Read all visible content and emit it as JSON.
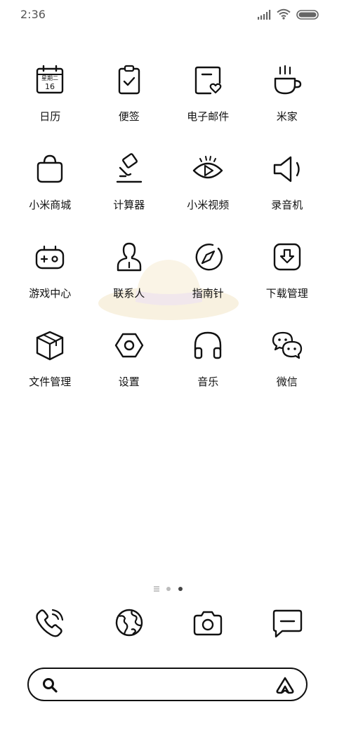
{
  "status_bar": {
    "time": "2:36",
    "icons": [
      "signal-icon",
      "wifi-icon",
      "battery-icon"
    ]
  },
  "apps": [
    {
      "label": "日历",
      "icon": "calendar-icon",
      "calendar_header": "星期二",
      "calendar_day": "16"
    },
    {
      "label": "便签",
      "icon": "notes-icon"
    },
    {
      "label": "电子邮件",
      "icon": "email-icon"
    },
    {
      "label": "米家",
      "icon": "mijia-cup-icon"
    },
    {
      "label": "小米商城",
      "icon": "shopping-bag-icon"
    },
    {
      "label": "计算器",
      "icon": "calculator-icon"
    },
    {
      "label": "小米视频",
      "icon": "video-eye-icon"
    },
    {
      "label": "录音机",
      "icon": "recorder-speaker-icon"
    },
    {
      "label": "游戏中心",
      "icon": "gamepad-icon"
    },
    {
      "label": "联系人",
      "icon": "contacts-icon"
    },
    {
      "label": "指南针",
      "icon": "compass-icon"
    },
    {
      "label": "下载管理",
      "icon": "download-icon"
    },
    {
      "label": "文件管理",
      "icon": "file-box-icon"
    },
    {
      "label": "设置",
      "icon": "settings-hex-icon"
    },
    {
      "label": "音乐",
      "icon": "headphones-icon"
    },
    {
      "label": "微信",
      "icon": "wechat-icon"
    }
  ],
  "page_indicator": {
    "pages": 3,
    "current": 3
  },
  "dock": [
    {
      "icon": "phone-icon"
    },
    {
      "icon": "browser-globe-icon"
    },
    {
      "icon": "camera-icon"
    },
    {
      "icon": "messages-icon"
    }
  ],
  "search_bar": {
    "placeholder": ""
  },
  "colors": {
    "background": "#ffffff",
    "foreground": "#111111",
    "hat": "#f3e6c8",
    "hat_band": "#e6d4de"
  }
}
